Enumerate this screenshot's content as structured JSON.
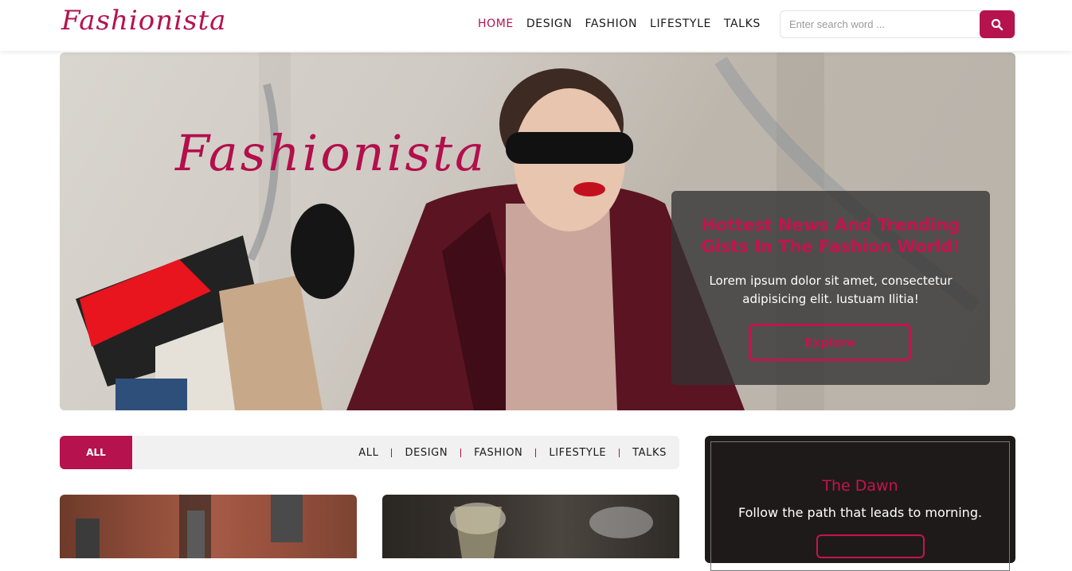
{
  "brand": {
    "name": "Fashionista",
    "accent": "#b5124e"
  },
  "nav": {
    "items": [
      {
        "label": "HOME",
        "active": true
      },
      {
        "label": "DESIGN",
        "active": false
      },
      {
        "label": "FASHION",
        "active": false
      },
      {
        "label": "LIFESTYLE",
        "active": false
      },
      {
        "label": "TALKS",
        "active": false
      }
    ]
  },
  "search": {
    "placeholder": "Enter search word ...",
    "value": "",
    "icon": "search-icon"
  },
  "hero": {
    "logo_text": "Fashionista",
    "title": "Hottest News And Trending Gists In The Fashion World!",
    "text": "Lorem ipsum dolor sit amet, consectetur adipisicing elit. Iustuam Ilitia!",
    "button_label": "Explore"
  },
  "filter": {
    "active_label": "ALL",
    "items": [
      "ALL",
      "DESIGN",
      "FASHION",
      "LIFESTYLE",
      "TALKS"
    ]
  },
  "widget": {
    "title": "The Dawn",
    "text": "Follow the path that leads to morning."
  }
}
